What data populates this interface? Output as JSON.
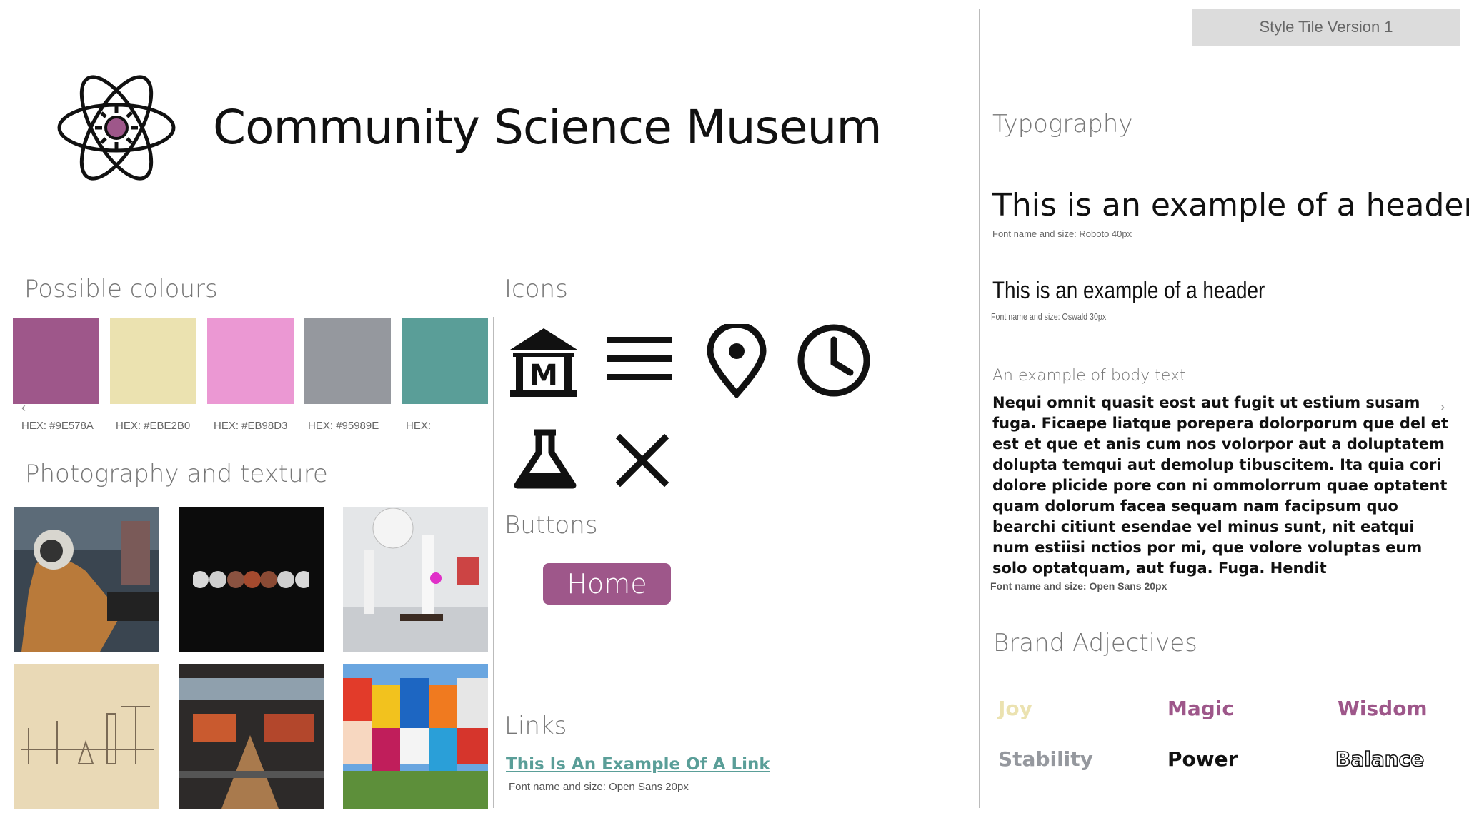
{
  "app": {
    "title": "Community Science Museum",
    "version": "Style Tile Version 1"
  },
  "sections": {
    "colours": "Possible colours",
    "photography": "Photography and texture",
    "icons": "Icons",
    "buttons": "Buttons",
    "links": "Links",
    "typography": "Typography",
    "brand": "Brand Adjectives"
  },
  "palette": [
    {
      "color": "#9E578A",
      "label": "HEX: #9E578A"
    },
    {
      "color": "#EBE2B0",
      "label": "HEX: #EBE2B0"
    },
    {
      "color": "#EB98D3",
      "label": "HEX: #EB98D3"
    },
    {
      "color": "#95989E",
      "label": "HEX: #95989E"
    },
    {
      "color": "#5A9E98",
      "label": "HEX:"
    }
  ],
  "icons": [
    "museum-icon",
    "menu-icon",
    "location-pin-icon",
    "clock-icon",
    "flask-icon",
    "close-icon",
    "chevron-left-icon",
    "chevron-right-icon"
  ],
  "buttons": {
    "home": "Home"
  },
  "links": {
    "example": "This Is An Example Of A Link",
    "caption": "Font name and size: Open Sans 20px"
  },
  "typography": {
    "header1": "This is an example of a header",
    "header1_caption": "Font name and size: Roboto 40px",
    "header2": "This is an example of a header",
    "header2_caption": "Font name and size: Oswald 30px",
    "body_title": "An example of body text",
    "body": "Nequi omnit quasit eost aut fugit ut estium susam fuga. Ficaepe liatque porepera dolorporum que del et est et que et anis cum nos volorpor aut a doluptatem dolupta temqui aut demolup tibuscitem. Ita quia cori dolore plicide pore con ni ommolorrum quae optatent quam dolorum facea sequam nam facipsum quo bearchi citiunt esendae vel minus sunt, nit eatqui num estiisi nctios por mi, que volore voluptas eum solo optatquam, aut fuga. Fuga. Hendit",
    "body_caption": "Font name and size: Open Sans 20px"
  },
  "adjectives": [
    {
      "label": "Joy",
      "color": "#EBE2B0"
    },
    {
      "label": "Magic",
      "color": "#9E578A"
    },
    {
      "label": "Wisdom",
      "color": "#9E578A"
    },
    {
      "label": "Stability",
      "color": "#95989E"
    },
    {
      "label": "Power",
      "color": "#111111"
    },
    {
      "label": "Balance",
      "color": "outline"
    }
  ]
}
